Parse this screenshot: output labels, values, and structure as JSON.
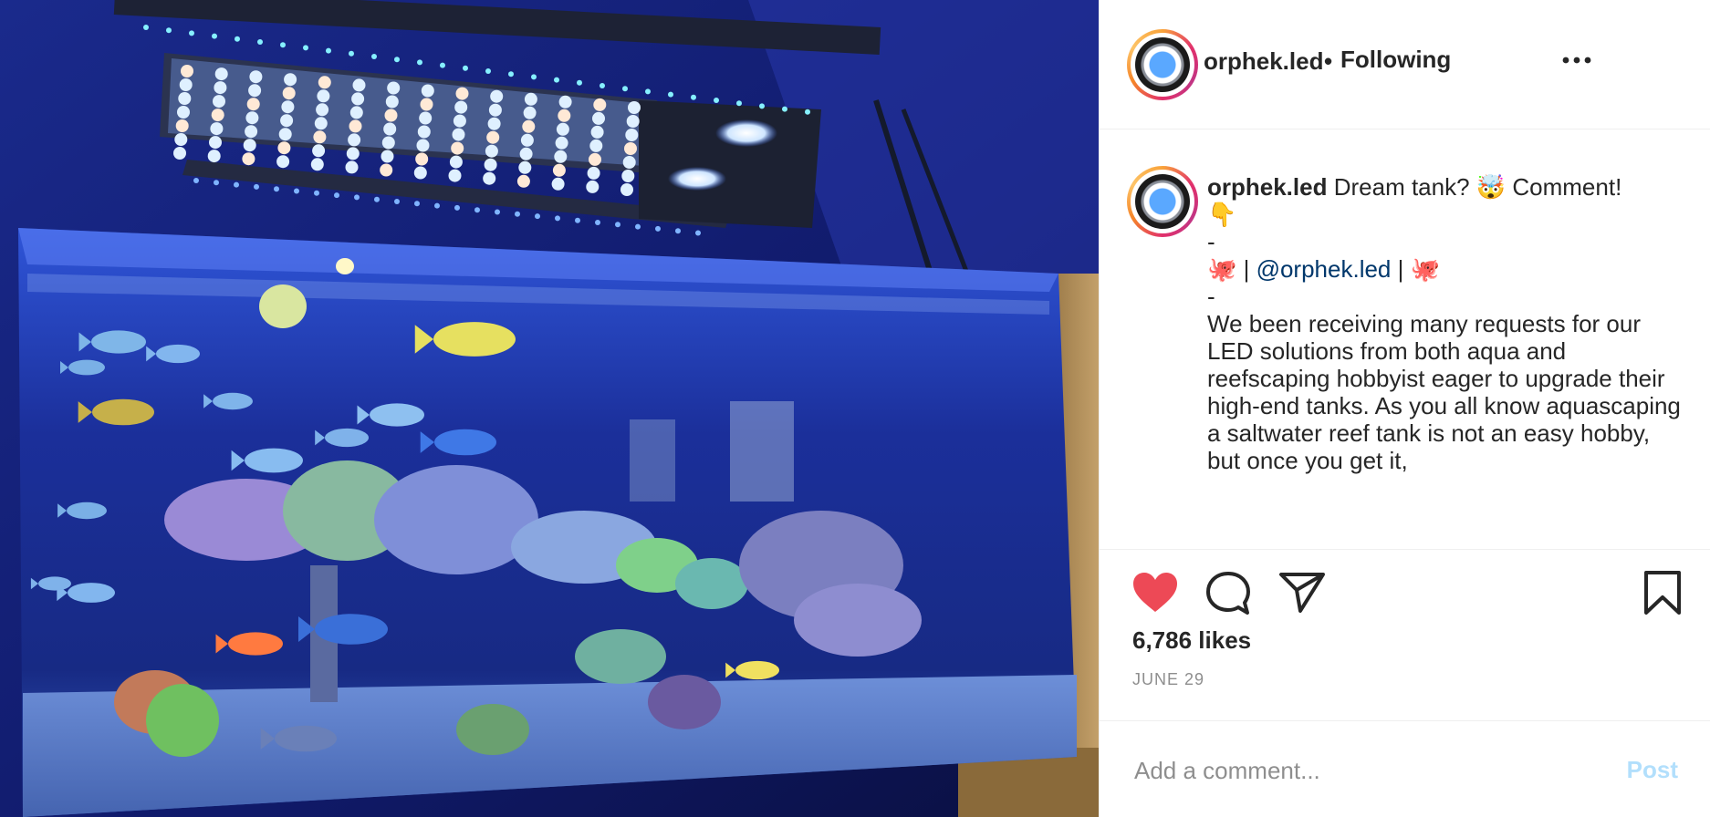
{
  "post": {
    "image_alt": "Reef aquarium with LED lighting",
    "image_icon": "aquarium-photo"
  },
  "header": {
    "username": "orphek.led",
    "separator": "•",
    "follow_status": "Following",
    "more_icon": "more-dots-icon"
  },
  "caption": {
    "username": "orphek.led",
    "line1_text": " Dream tank? 🤯 Comment!",
    "line2": "👇",
    "dash1": "-",
    "octopus_left": "🐙",
    "pipe_left": " | ",
    "mention": "@orphek.led",
    "pipe_right": " | ",
    "octopus_right": "🐙",
    "dash2": "-",
    "body": "We been receiving many requests for our LED solutions from both aqua and reefscaping hobbyist eager to upgrade their high-end tanks. As you all know aquascaping a saltwater reef tank is not an easy hobby, but once you get it,"
  },
  "actions": {
    "like_icon": "heart-filled-icon",
    "comment_icon": "comment-icon",
    "share_icon": "share-icon",
    "save_icon": "bookmark-icon",
    "like_color": "#ed4956",
    "likes": "6,786 likes",
    "date": "JUNE 29"
  },
  "composer": {
    "placeholder": "Add a comment...",
    "post_label": "Post",
    "post_color": "#b2dffc"
  }
}
